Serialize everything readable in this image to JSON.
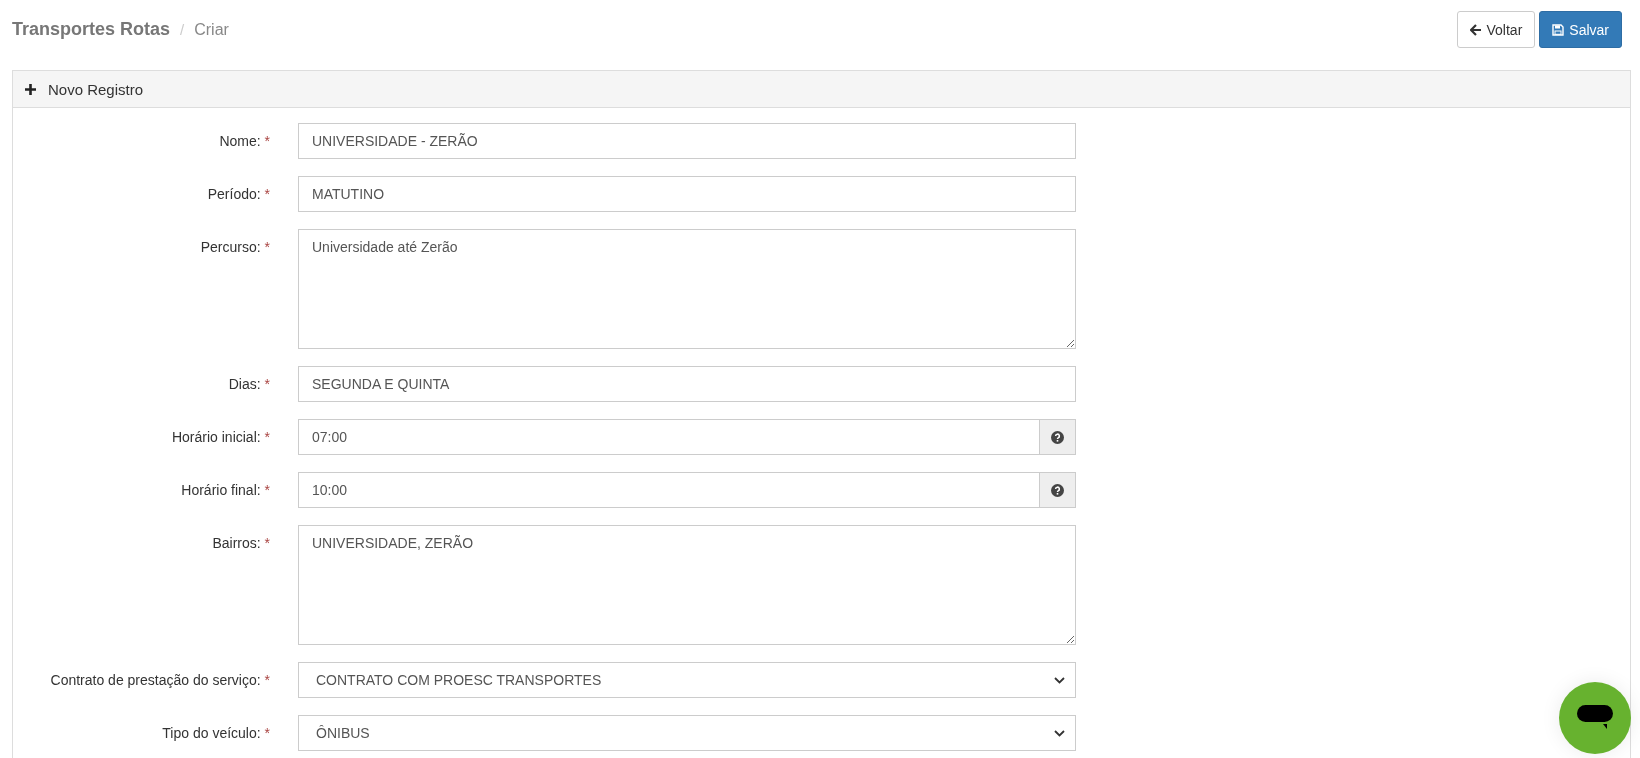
{
  "header": {
    "title": "Transportes Rotas",
    "separator": "/",
    "current": "Criar"
  },
  "actions": [
    {
      "kind": "back",
      "label": "Voltar"
    },
    {
      "kind": "save",
      "label": "Salvar"
    }
  ],
  "panel": {
    "title": "Novo Registro",
    "fields": [
      {
        "kind": "text",
        "label": "Nome:",
        "required_mark": "*",
        "value": "UNIVERSIDADE - ZERÃO"
      },
      {
        "kind": "text",
        "label": "Período:",
        "required_mark": "*",
        "value": "MATUTINO"
      },
      {
        "kind": "textarea",
        "label": "Percurso:",
        "required_mark": "*",
        "value": "Universidade até Zerão"
      },
      {
        "kind": "text",
        "label": "Dias:",
        "required_mark": "*",
        "value": "SEGUNDA E QUINTA"
      },
      {
        "kind": "time",
        "label": "Horário inicial:",
        "required_mark": "*",
        "value": "07:00"
      },
      {
        "kind": "time",
        "label": "Horário final:",
        "required_mark": "*",
        "value": "10:00"
      },
      {
        "kind": "textarea",
        "label": "Bairros:",
        "required_mark": "*",
        "value": "UNIVERSIDADE, ZERÃO"
      },
      {
        "kind": "select",
        "label": "Contrato de prestação do serviço:",
        "required_mark": "*",
        "value": "CONTRATO COM PROESC TRANSPORTES"
      },
      {
        "kind": "select",
        "label": "Tipo do veículo:",
        "required_mark": "*",
        "value": "ÔNIBUS"
      }
    ]
  }
}
